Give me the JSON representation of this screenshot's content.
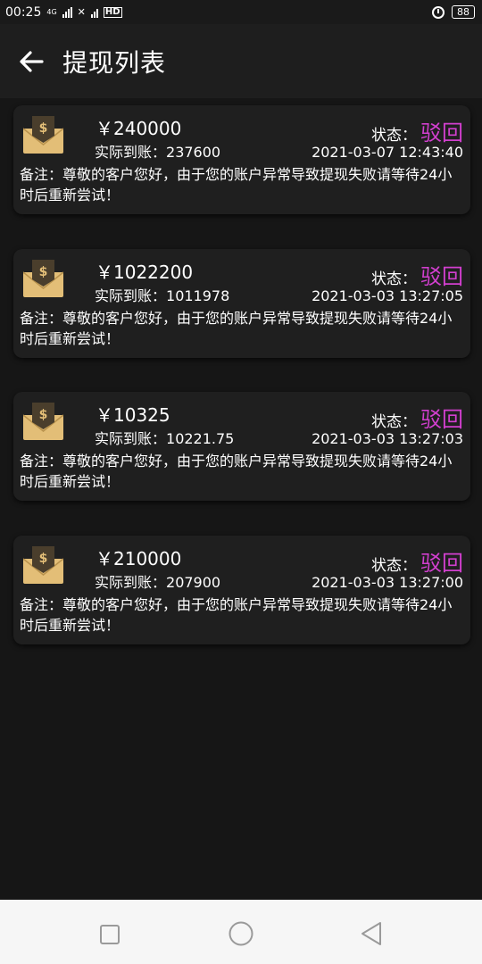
{
  "status_bar": {
    "time": "00:25",
    "network": "4G",
    "hd": "HD",
    "battery": "88"
  },
  "header": {
    "title": "提现列表"
  },
  "withdrawals": [
    {
      "amount": "￥240000",
      "actual_label": "实际到账：",
      "actual_value": "237600",
      "status_label": "状态：",
      "status_value": "驳回",
      "time": "2021-03-07 12:43:40",
      "remark": "备注：尊敬的客户您好，由于您的账户异常导致提现失败请等待24小时后重新尝试！"
    },
    {
      "amount": "￥1022200",
      "actual_label": "实际到账：",
      "actual_value": "1011978",
      "status_label": "状态：",
      "status_value": "驳回",
      "time": "2021-03-03 13:27:05",
      "remark": "备注：尊敬的客户您好，由于您的账户异常导致提现失败请等待24小时后重新尝试！"
    },
    {
      "amount": "￥10325",
      "actual_label": "实际到账：",
      "actual_value": "10221.75",
      "status_label": "状态：",
      "status_value": "驳回",
      "time": "2021-03-03 13:27:03",
      "remark": "备注：尊敬的客户您好，由于您的账户异常导致提现失败请等待24小时后重新尝试！"
    },
    {
      "amount": "￥210000",
      "actual_label": "实际到账：",
      "actual_value": "207900",
      "status_label": "状态：",
      "status_value": "驳回",
      "time": "2021-03-03 13:27:00",
      "remark": "备注：尊敬的客户您好，由于您的账户异常导致提现失败请等待24小时后重新尝试！"
    }
  ],
  "colors": {
    "background": "#161616",
    "card": "#1f1f1f",
    "status_rejected": "#d23fcf",
    "envelope_gold": "#e3be77"
  },
  "icons": {
    "back": "arrow-left-icon",
    "envelope": "money-envelope-icon",
    "nav_recent": "square-icon",
    "nav_home": "circle-icon",
    "nav_back": "triangle-back-icon"
  }
}
